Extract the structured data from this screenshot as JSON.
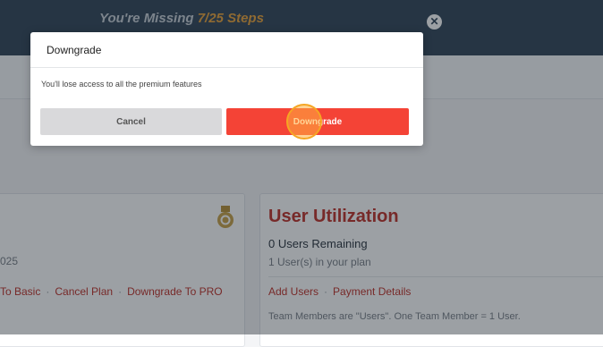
{
  "topbar": {
    "missing_prefix": "You're Missing",
    "missing_steps": "7/25 Steps",
    "close_icon": "close-icon"
  },
  "plan_card": {
    "date_text": "025",
    "links": [
      "To Basic",
      "Cancel Plan",
      "Downgrade To PRO"
    ],
    "medal_icon": "medal-icon"
  },
  "utilization_card": {
    "title": "User Utilization",
    "remaining": "0 Users Remaining",
    "plan_users": "1 User(s) in your plan",
    "links": [
      "Add Users",
      "Payment Details"
    ],
    "note": "Team Members are \"Users\". One Team Member = 1 User."
  },
  "dialog": {
    "title": "Downgrade",
    "message": "You'll lose access to all the premium features",
    "cancel_label": "Cancel",
    "confirm_label": "Downgrade"
  },
  "colors": {
    "topbar": "#34475b",
    "accent": "#c0342c",
    "confirm_button": "#f44336",
    "steps_highlight": "#e8a23b"
  }
}
